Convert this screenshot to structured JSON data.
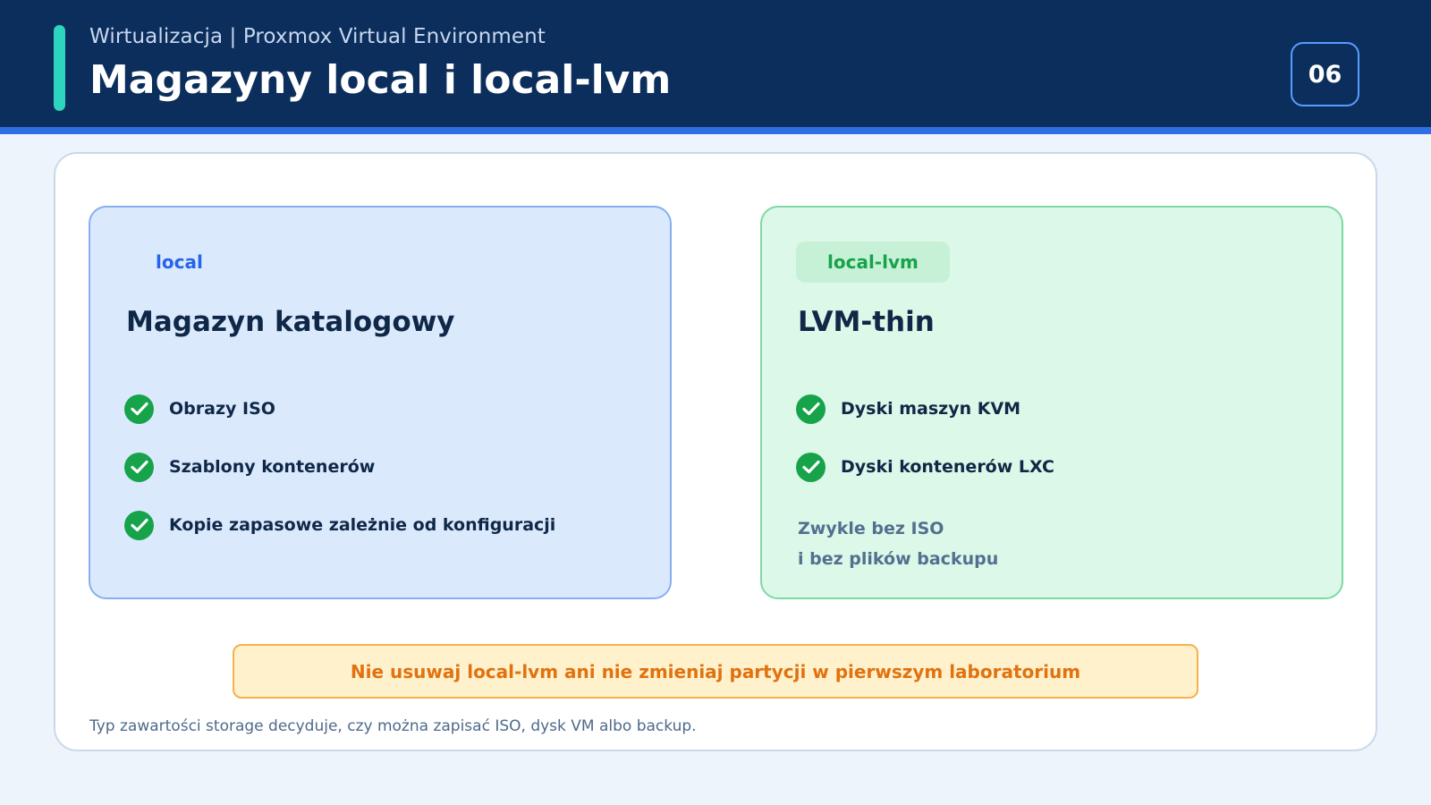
{
  "header": {
    "subtitle": "Wirtualizacja | Proxmox Virtual Environment",
    "title": "Magazyny local i local-lvm",
    "page_number": "06"
  },
  "cards": [
    {
      "tag": "local",
      "heading": "Magazyn katalogowy",
      "items": [
        "Obrazy ISO",
        "Szablony kontenerów",
        "Kopie zapasowe zależnie od konfiguracji"
      ]
    },
    {
      "tag": "local-lvm",
      "heading": "LVM-thin",
      "items": [
        "Dyski maszyn KVM",
        "Dyski kontenerów LXC"
      ],
      "note": [
        "Zwykle bez ISO",
        "i bez plików backupu"
      ]
    }
  ],
  "warning": "Nie usuwaj local-lvm ani nie zmieniaj partycji w pierwszym laboratorium",
  "footnote": "Typ zawartości storage decyduje, czy można zapisać ISO, dysk VM albo backup.",
  "icons": {
    "feature_icon": "check-circle-icon"
  },
  "colors": {
    "header_bg": "#0c2e5c",
    "accent": "#2dd4bf",
    "local_blue": "#2563eb",
    "lvm_green": "#16a34a",
    "warning_orange": "#e0720f"
  }
}
